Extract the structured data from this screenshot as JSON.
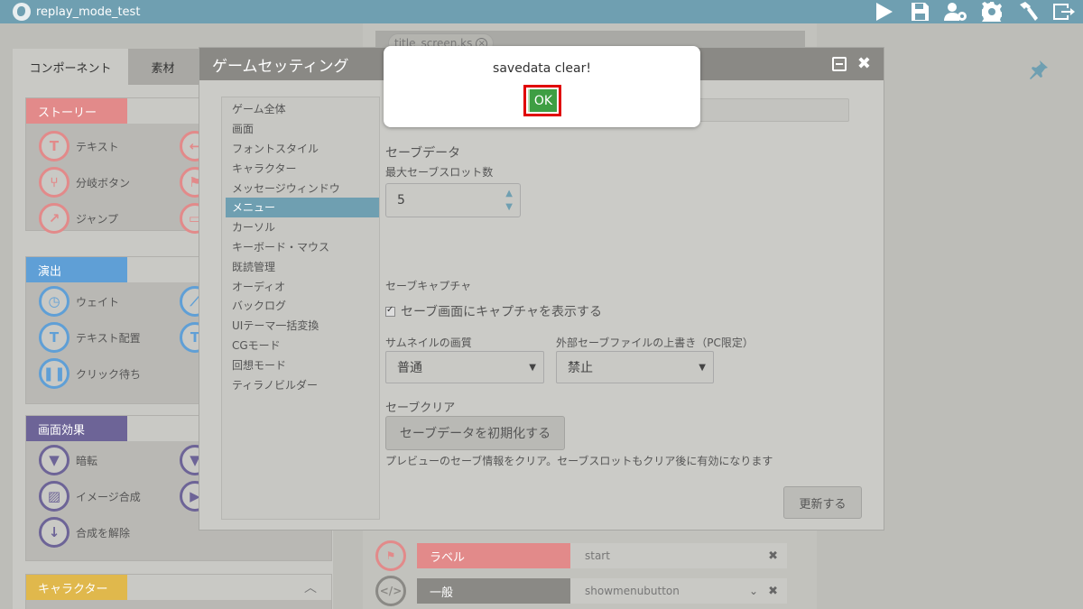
{
  "app": {
    "title": "replay_mode_test"
  },
  "toolbar_icons": [
    "play-icon",
    "save-icon",
    "user-settings-icon",
    "gear-icon",
    "build-hammer-icon",
    "export-icon"
  ],
  "left_panel": {
    "tabs": [
      {
        "label": "コンポーネント"
      },
      {
        "label": "素材"
      }
    ],
    "groups": {
      "story": {
        "label": "ストーリー",
        "color": "#e28a8a",
        "items": [
          "テキスト",
          "分岐ボタン",
          "ジャンプ"
        ]
      },
      "effect": {
        "label": "演出",
        "color": "#5f9fd6",
        "items": [
          "ウェイト",
          "テキスト配置",
          "クリック待ち"
        ]
      },
      "screen": {
        "label": "画面効果",
        "color": "#6d6497",
        "items": [
          "暗転",
          "イメージ合成",
          "合成を解除"
        ]
      },
      "character": {
        "label": "キャラクター",
        "color": "#e0b84c"
      }
    }
  },
  "script": {
    "tab": {
      "label": "title_screen.ks"
    },
    "rows": [
      {
        "tag": "ラベル",
        "value": "start",
        "color": "#e28a8a"
      },
      {
        "tag": "一般",
        "value": "showmenubutton",
        "color": "#8a8985"
      }
    ]
  },
  "dialog": {
    "title": "ゲームセッティング",
    "nav": [
      "ゲーム全体",
      "画面",
      "フォントスタイル",
      "キャラクター",
      "メッセージウィンドウ",
      "メニュー",
      "カーソル",
      "キーボード・マウス",
      "既読管理",
      "オーディオ",
      "バックログ",
      "UIテーマ一括変換",
      "CGモード",
      "回想モード",
      "ティラノビルダー"
    ],
    "active_nav": "メニュー",
    "save_data": {
      "section": "セーブデータ",
      "max_slots_label": "最大セーブスロット数",
      "max_slots_value": "5"
    },
    "save_capture": {
      "section": "セーブキャプチャ",
      "checkbox_label": "セーブ画面にキャプチャを表示する",
      "checked": true
    },
    "thumbnail": {
      "label": "サムネイルの画質",
      "value": "普通"
    },
    "external_overwrite": {
      "label": "外部セーブファイルの上書き（PC限定）",
      "value": "禁止"
    },
    "save_clear": {
      "section": "セーブクリア",
      "button": "セーブデータを初期化する",
      "note": "プレビューのセーブ情報をクリア。セーブスロットもクリア後に有効になります"
    },
    "update_button": "更新する"
  },
  "alert": {
    "message": "savedata clear!",
    "ok_label": "OK"
  }
}
